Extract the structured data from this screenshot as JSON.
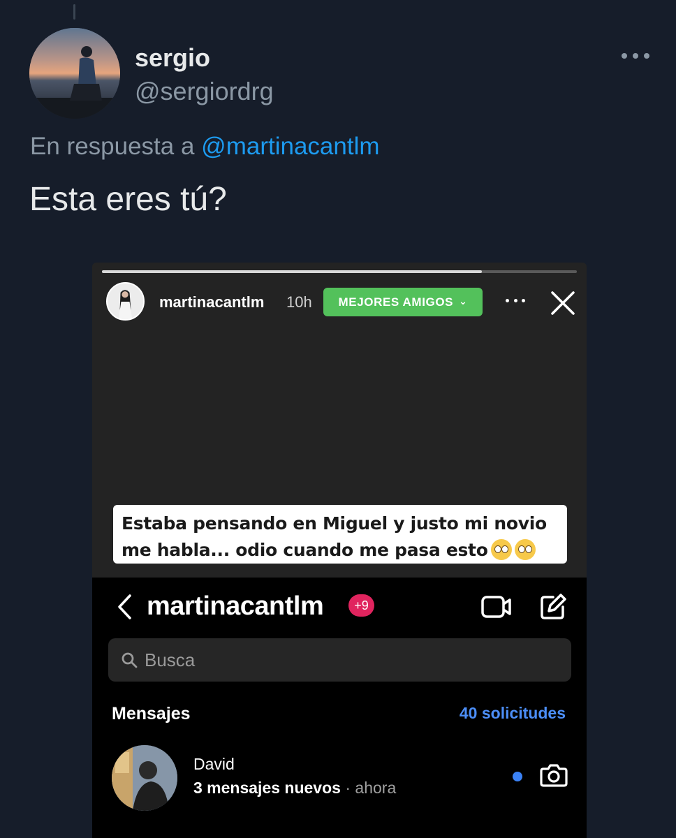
{
  "tweet": {
    "display_name": "sergio",
    "handle": "@sergiordrg",
    "reply_prefix": "En respuesta a",
    "reply_to": "@martinacantlm",
    "text": "Esta eres tú?",
    "icons": {
      "more": "more-horizontal-icon"
    }
  },
  "story": {
    "progress": 0.8,
    "username": "martinacantlm",
    "time": "10h",
    "badge": "MEJORES AMIGOS",
    "badge_color": "#53c15b",
    "caption_line1": "Estaba pensando en Miguel y justo mi novio",
    "caption_line2": "me habla... odio cuando me pasa esto",
    "caption_emojis": [
      "eye-roll-emoji",
      "eye-roll-emoji"
    ],
    "icons": {
      "more": "more-horizontal-icon",
      "close": "close-icon",
      "expand": "chevron-down-icon"
    }
  },
  "dm": {
    "title": "martinacantlm",
    "badge_count": "+9",
    "search_placeholder": "Busca",
    "section_label": "Mensajes",
    "requests_label": "40 solicitudes",
    "accent_color": "#4c8ef7",
    "conversations": [
      {
        "name": "David",
        "preview": "3 mensajes nuevos",
        "separator": "·",
        "time": "ahora",
        "unread": true
      }
    ],
    "icons": {
      "back": "chevron-left-icon",
      "video": "video-camera-icon",
      "compose": "compose-icon",
      "search": "search-icon",
      "camera": "camera-icon"
    }
  }
}
